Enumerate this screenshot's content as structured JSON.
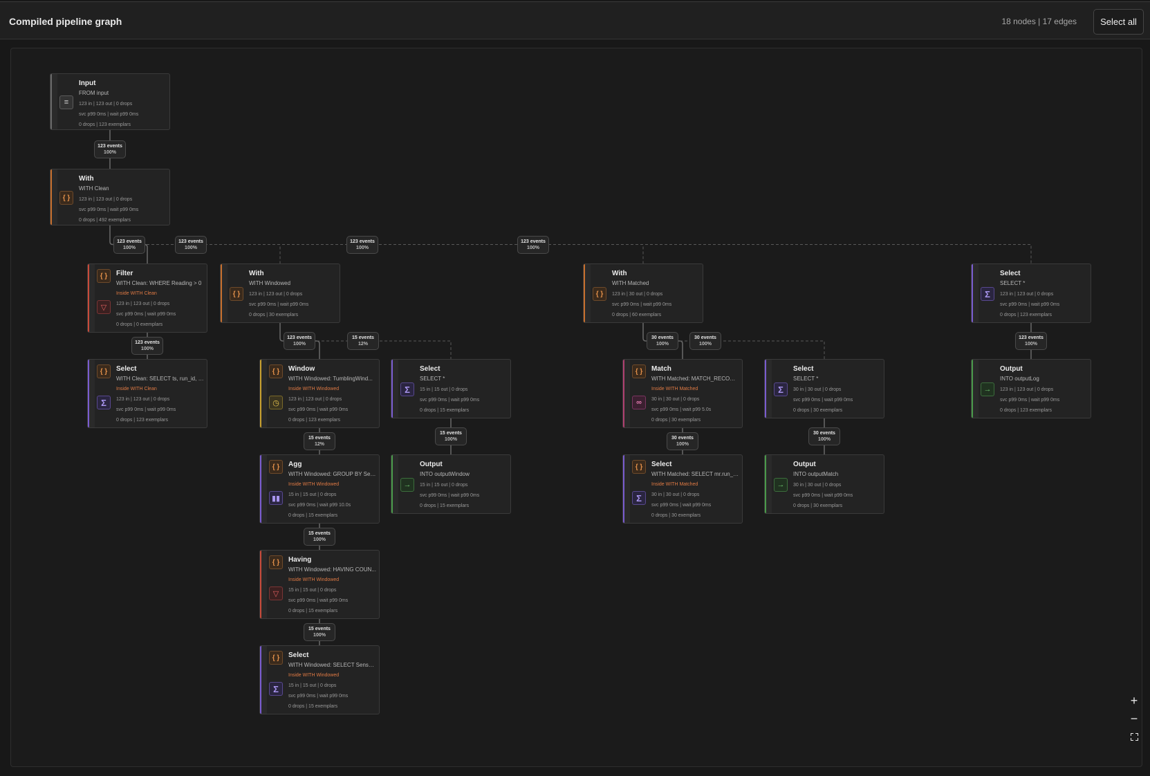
{
  "header": {
    "title": "Compiled pipeline graph",
    "stats": "18 nodes | 17 edges",
    "select_all": "Select all"
  },
  "nodes": [
    {
      "id": "n1",
      "name": "Input",
      "sub": "FROM input",
      "inside": "",
      "m1": "123 in | 123 out | 0 drops",
      "m2": "svc p99 0ms | wait p99 0ms",
      "m3": "0 drops | 123 exemplars",
      "accent": "#6a6a6a",
      "icons": [
        "database-icon"
      ]
    },
    {
      "id": "n2",
      "name": "With",
      "sub": "WITH Clean",
      "inside": "",
      "m1": "123 in | 123 out | 0 drops",
      "m2": "svc p99 0ms | wait p99 0ms",
      "m3": "0 drops | 492 exemplars",
      "accent": "#c8702e",
      "icons": [
        "braces-icon"
      ]
    },
    {
      "id": "n3",
      "name": "Filter",
      "sub": "WITH Clean: WHERE Reading > 0",
      "inside": "Inside WITH Clean",
      "m1": "123 in | 123 out | 0 drops",
      "m2": "svc p99 0ms | wait p99 0ms",
      "m3": "0 drops | 0 exemplars",
      "accent": "#c84a3a",
      "icons": [
        "braces-icon",
        "filter-icon"
      ]
    },
    {
      "id": "n4",
      "name": "Select",
      "sub": "WITH Clean: SELECT ts, run_id, Se...",
      "inside": "Inside WITH Clean",
      "m1": "123 in | 123 out | 0 drops",
      "m2": "svc p99 0ms | wait p99 0ms",
      "m3": "0 drops | 123 exemplars",
      "accent": "#7a5cd0",
      "icons": [
        "braces-icon",
        "sigma-icon"
      ]
    },
    {
      "id": "n5",
      "name": "With",
      "sub": "WITH Windowed",
      "inside": "",
      "m1": "123 in | 123 out | 0 drops",
      "m2": "svc p99 0ms | wait p99 0ms",
      "m3": "0 drops | 30 exemplars",
      "accent": "#c8702e",
      "icons": [
        "braces-icon"
      ]
    },
    {
      "id": "n6",
      "name": "Window",
      "sub": "WITH Windowed: TumblingWind...",
      "inside": "Inside WITH Windowed",
      "m1": "123 in | 123 out | 0 drops",
      "m2": "svc p99 0ms | wait p99 0ms",
      "m3": "0 drops | 123 exemplars",
      "accent": "#c8a02e",
      "icons": [
        "braces-icon",
        "clock-icon"
      ]
    },
    {
      "id": "n7",
      "name": "Agg",
      "sub": "WITH Windowed: GROUP BY Sens...",
      "inside": "Inside WITH Windowed",
      "m1": "15 in | 15 out | 0 drops",
      "m2": "svc p99 0ms | wait p99 10.0s",
      "m3": "0 drops | 15 exemplars",
      "accent": "#7a5cd0",
      "icons": [
        "braces-icon",
        "bar-chart-icon"
      ]
    },
    {
      "id": "n8",
      "name": "Having",
      "sub": "WITH Windowed: HAVING COUN...",
      "inside": "Inside WITH Windowed",
      "m1": "15 in | 15 out | 0 drops",
      "m2": "svc p99 0ms | wait p99 0ms",
      "m3": "0 drops | 15 exemplars",
      "accent": "#c84a3a",
      "icons": [
        "braces-icon",
        "filter-icon"
      ]
    },
    {
      "id": "n9",
      "name": "Select",
      "sub": "WITH Windowed: SELECT SensorI...",
      "inside": "Inside WITH Windowed",
      "m1": "15 in | 15 out | 0 drops",
      "m2": "svc p99 0ms | wait p99 0ms",
      "m3": "0 drops | 15 exemplars",
      "accent": "#7a5cd0",
      "icons": [
        "braces-icon",
        "sigma-icon"
      ]
    },
    {
      "id": "n10",
      "name": "Select",
      "sub": "SELECT *",
      "inside": "",
      "m1": "15 in | 15 out | 0 drops",
      "m2": "svc p99 0ms | wait p99 0ms",
      "m3": "0 drops | 15 exemplars",
      "accent": "#7a5cd0",
      "icons": [
        "sigma-icon"
      ]
    },
    {
      "id": "n11",
      "name": "Output",
      "sub": "INTO outputWindow",
      "inside": "",
      "m1": "15 in | 15 out | 0 drops",
      "m2": "svc p99 0ms | wait p99 0ms",
      "m3": "0 drops | 15 exemplars",
      "accent": "#4a9a4a",
      "icons": [
        "output-icon"
      ]
    },
    {
      "id": "n12",
      "name": "With",
      "sub": "WITH Matched",
      "inside": "",
      "m1": "123 in | 30 out | 0 drops",
      "m2": "svc p99 0ms | wait p99 0ms",
      "m3": "0 drops | 60 exemplars",
      "accent": "#c8702e",
      "icons": [
        "braces-icon"
      ]
    },
    {
      "id": "n13",
      "name": "Match",
      "sub": "WITH Matched: MATCH_RECOGNI...",
      "inside": "Inside WITH Matched",
      "m1": "30 in | 30 out | 0 drops",
      "m2": "svc p99 0ms | wait p99 5.0s",
      "m3": "0 drops | 30 exemplars",
      "accent": "#b04070",
      "icons": [
        "braces-icon",
        "match-icon"
      ]
    },
    {
      "id": "n14",
      "name": "Select",
      "sub": "WITH Matched: SELECT mr.run_id,...",
      "inside": "Inside WITH Matched",
      "m1": "30 in | 30 out | 0 drops",
      "m2": "svc p99 0ms | wait p99 0ms",
      "m3": "0 drops | 30 exemplars",
      "accent": "#7a5cd0",
      "icons": [
        "braces-icon",
        "sigma-icon"
      ]
    },
    {
      "id": "n15",
      "name": "Select",
      "sub": "SELECT *",
      "inside": "",
      "m1": "30 in | 30 out | 0 drops",
      "m2": "svc p99 0ms | wait p99 0ms",
      "m3": "0 drops | 30 exemplars",
      "accent": "#7a5cd0",
      "icons": [
        "sigma-icon"
      ]
    },
    {
      "id": "n16",
      "name": "Output",
      "sub": "INTO outputMatch",
      "inside": "",
      "m1": "30 in | 30 out | 0 drops",
      "m2": "svc p99 0ms | wait p99 0ms",
      "m3": "0 drops | 30 exemplars",
      "accent": "#4a9a4a",
      "icons": [
        "output-icon"
      ]
    },
    {
      "id": "n17",
      "name": "Select",
      "sub": "SELECT *",
      "inside": "",
      "m1": "123 in | 123 out | 0 drops",
      "m2": "svc p99 0ms | wait p99 0ms",
      "m3": "0 drops | 123 exemplars",
      "accent": "#7a5cd0",
      "icons": [
        "sigma-icon"
      ]
    },
    {
      "id": "n18",
      "name": "Output",
      "sub": "INTO outputLog",
      "inside": "",
      "m1": "123 in | 123 out | 0 drops",
      "m2": "svc p99 0ms | wait p99 0ms",
      "m3": "0 drops | 123 exemplars",
      "accent": "#4a9a4a",
      "icons": [
        "output-icon"
      ]
    }
  ],
  "edges": [
    {
      "id": "e1",
      "from": "n1",
      "to": "n2",
      "events": "123 events",
      "pct": "100%"
    },
    {
      "id": "e2",
      "from": "n2",
      "to": "n3",
      "events": "123 events",
      "pct": "100%"
    },
    {
      "id": "e3",
      "from": "n2",
      "to": "n5",
      "events": "123 events",
      "pct": "100%"
    },
    {
      "id": "e4",
      "from": "n2",
      "to": "n12",
      "events": "123 events",
      "pct": "100%"
    },
    {
      "id": "e5",
      "from": "n2",
      "to": "n17",
      "events": "123 events",
      "pct": "100%"
    },
    {
      "id": "e6",
      "from": "n3",
      "to": "n4",
      "events": "123 events",
      "pct": "100%"
    },
    {
      "id": "e7",
      "from": "n5",
      "to": "n6",
      "events": "123 events",
      "pct": "100%"
    },
    {
      "id": "e8",
      "from": "n5",
      "to": "n10",
      "events": "15 events",
      "pct": "12%"
    },
    {
      "id": "e9",
      "from": "n6",
      "to": "n7",
      "events": "15 events",
      "pct": "12%"
    },
    {
      "id": "e10",
      "from": "n7",
      "to": "n8",
      "events": "15 events",
      "pct": "100%"
    },
    {
      "id": "e11",
      "from": "n8",
      "to": "n9",
      "events": "15 events",
      "pct": "100%"
    },
    {
      "id": "e12",
      "from": "n10",
      "to": "n11",
      "events": "15 events",
      "pct": "100%"
    },
    {
      "id": "e13",
      "from": "n12",
      "to": "n13",
      "events": "30 events",
      "pct": "100%"
    },
    {
      "id": "e14",
      "from": "n12",
      "to": "n15",
      "events": "30 events",
      "pct": "100%"
    },
    {
      "id": "e15",
      "from": "n13",
      "to": "n14",
      "events": "30 events",
      "pct": "100%"
    },
    {
      "id": "e16",
      "from": "n15",
      "to": "n16",
      "events": "30 events",
      "pct": "100%"
    },
    {
      "id": "e17",
      "from": "n17",
      "to": "n18",
      "events": "123 events",
      "pct": "100%"
    }
  ],
  "controls": {
    "zoom_in": "+",
    "zoom_out": "−"
  }
}
